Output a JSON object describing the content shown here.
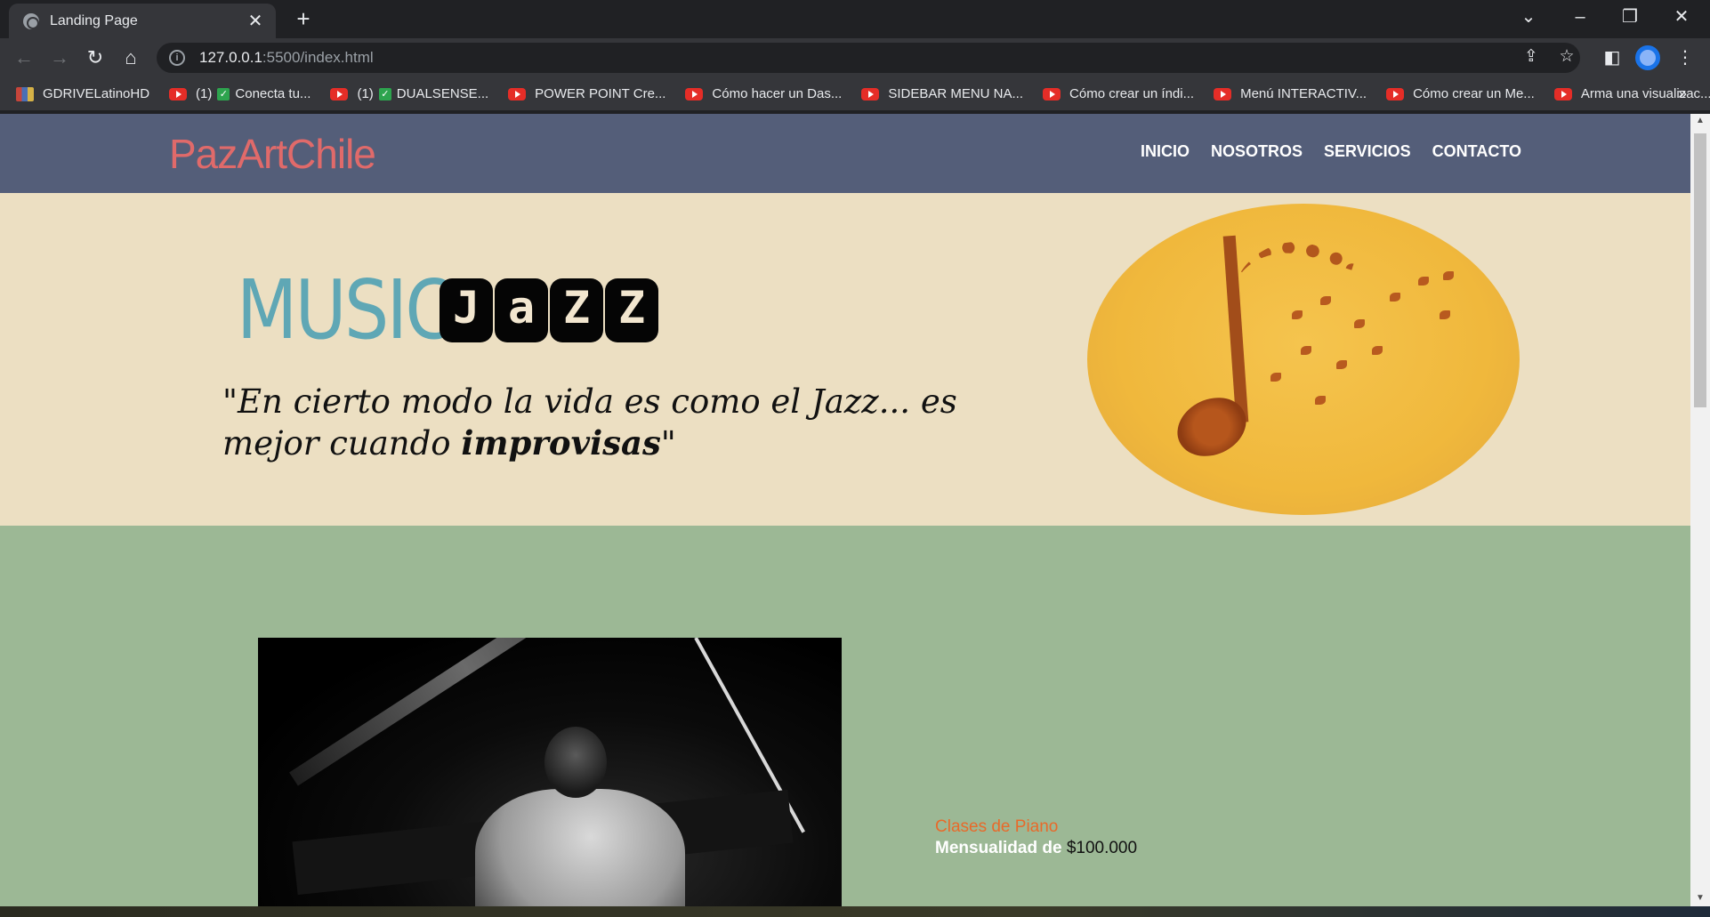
{
  "browser": {
    "tab_title": "Landing Page",
    "url_host": "127.0.0.1",
    "url_path": ":5500/index.html",
    "bookmarks": [
      {
        "label": "GDRIVELatinoHD",
        "icon": "drive-icon"
      },
      {
        "label": "(1)",
        "check": true,
        "label2": "Conecta tu...",
        "icon": "youtube-icon"
      },
      {
        "label": "(1)",
        "check": true,
        "label2": "DUALSENSE...",
        "icon": "youtube-icon"
      },
      {
        "label": "POWER POINT Cre...",
        "icon": "youtube-icon"
      },
      {
        "label": "Cómo hacer un Das...",
        "icon": "youtube-icon"
      },
      {
        "label": "SIDEBAR MENU NA...",
        "icon": "youtube-icon"
      },
      {
        "label": "Cómo crear un índi...",
        "icon": "youtube-icon"
      },
      {
        "label": "Menú INTERACTIV...",
        "icon": "youtube-icon"
      },
      {
        "label": "Cómo crear un Me...",
        "icon": "youtube-icon"
      },
      {
        "label": "Arma una visualizac...",
        "icon": "youtube-icon"
      }
    ],
    "more_bookmarks": "»"
  },
  "site": {
    "logo": "PazArtChile",
    "nav": [
      "INICIO",
      "NOSOTROS",
      "SERVICIOS",
      "CONTACTO"
    ],
    "hero": {
      "music_word": "MUSIC",
      "jazz_letters": [
        "J",
        "a",
        "Z",
        "Z"
      ],
      "quote_part1": "\"En cierto modo la vida es como el Jazz... es mejor cuando ",
      "quote_bold": "improvisas",
      "quote_end": "\""
    },
    "service": {
      "title": "Clases de Piano",
      "price_label": "Mensualidad de ",
      "price": "$100.000"
    }
  },
  "colors": {
    "nav_bg": "#545e79",
    "logo": "#e06a6a",
    "hero_bg": "#ecdfc2",
    "music_word": "#5fa7b5",
    "section_bg": "#9cb895",
    "service_title": "#e86a2a"
  }
}
